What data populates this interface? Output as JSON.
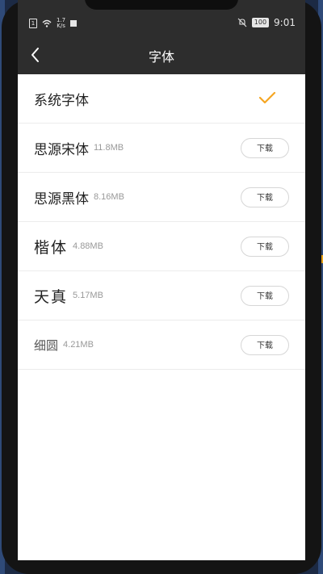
{
  "status_bar": {
    "speed": "1.7\nK/s",
    "battery": "100",
    "time": "9:01"
  },
  "nav": {
    "title": "字体",
    "back_icon": "chevron-left-icon"
  },
  "fonts": [
    {
      "name": "系统字体",
      "size": "",
      "selected": true
    },
    {
      "name": "思源宋体",
      "size": "11.8MB",
      "button": "下载"
    },
    {
      "name": "思源黑体",
      "size": "8.16MB",
      "button": "下载"
    },
    {
      "name": "楷体",
      "size": "4.88MB",
      "button": "下载"
    },
    {
      "name": "天真",
      "size": "5.17MB",
      "button": "下载"
    },
    {
      "name": "细圆",
      "size": "4.21MB",
      "button": "下载"
    }
  ],
  "colors": {
    "bar": "#2d2d2d",
    "check": "#f5a623",
    "frame_accent": "#e8a317"
  }
}
